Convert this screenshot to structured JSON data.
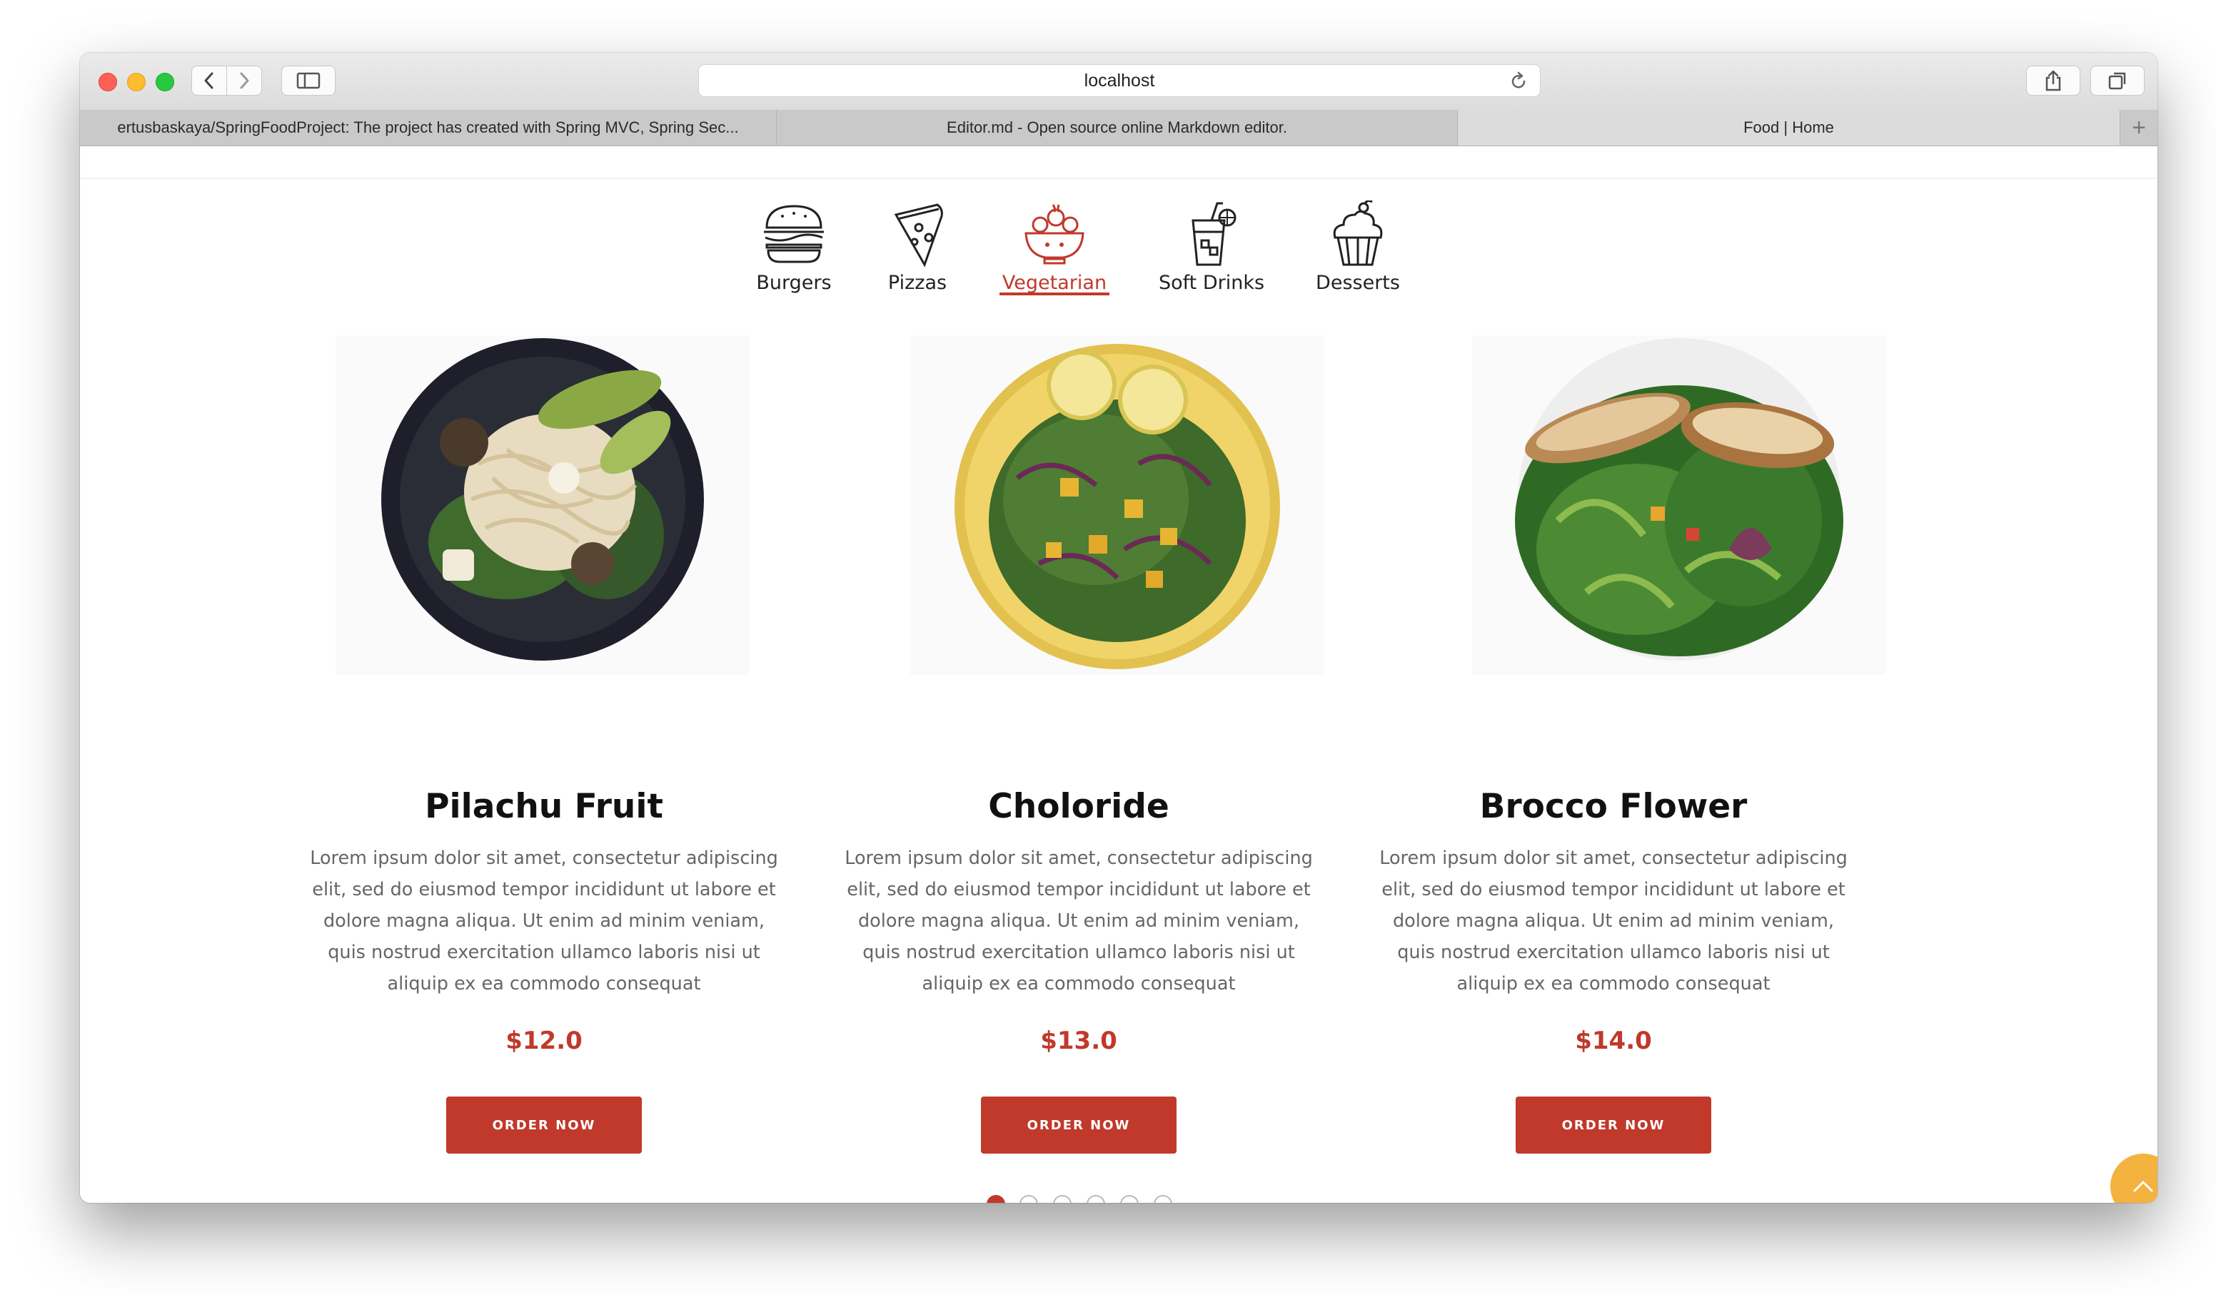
{
  "browser": {
    "address": "localhost",
    "tabs": [
      {
        "title": "ertusbaskaya/SpringFoodProject: The project has created with Spring MVC, Spring Sec..."
      },
      {
        "title": "Editor.md - Open source online Markdown editor."
      },
      {
        "title": "Food | Home",
        "active": true
      }
    ],
    "new_tab": "+"
  },
  "categories": [
    {
      "label": "Burgers",
      "icon": "burger-icon"
    },
    {
      "label": "Pizzas",
      "icon": "pizza-icon"
    },
    {
      "label": "Vegetarian",
      "icon": "salad-bowl-icon",
      "active": true
    },
    {
      "label": "Soft Drinks",
      "icon": "drink-icon"
    },
    {
      "label": "Desserts",
      "icon": "cupcake-icon"
    }
  ],
  "products": [
    {
      "name": "Pilachu Fruit",
      "description": "Lorem ipsum dolor sit amet, consectetur adipiscing elit, sed do eiusmod tempor incididunt ut labore et dolore magna aliqua. Ut enim ad minim veniam, quis nostrud exercitation ullamco laboris nisi ut aliquip ex ea commodo consequat",
      "price": "$12.0",
      "button": "ORDER NOW"
    },
    {
      "name": "Choloride",
      "description": "Lorem ipsum dolor sit amet, consectetur adipiscing elit, sed do eiusmod tempor incididunt ut labore et dolore magna aliqua. Ut enim ad minim veniam, quis nostrud exercitation ullamco laboris nisi ut aliquip ex ea commodo consequat",
      "price": "$13.0",
      "button": "ORDER NOW"
    },
    {
      "name": "Brocco Flower",
      "description": "Lorem ipsum dolor sit amet, consectetur adipiscing elit, sed do eiusmod tempor incididunt ut labore et dolore magna aliqua. Ut enim ad minim veniam, quis nostrud exercitation ullamco laboris nisi ut aliquip ex ea commodo consequat",
      "price": "$14.0",
      "button": "ORDER NOW"
    }
  ],
  "pagination": {
    "pages": 6,
    "current": 1
  },
  "colors": {
    "accent": "#c0392b",
    "to_top": "#f3b33e"
  }
}
